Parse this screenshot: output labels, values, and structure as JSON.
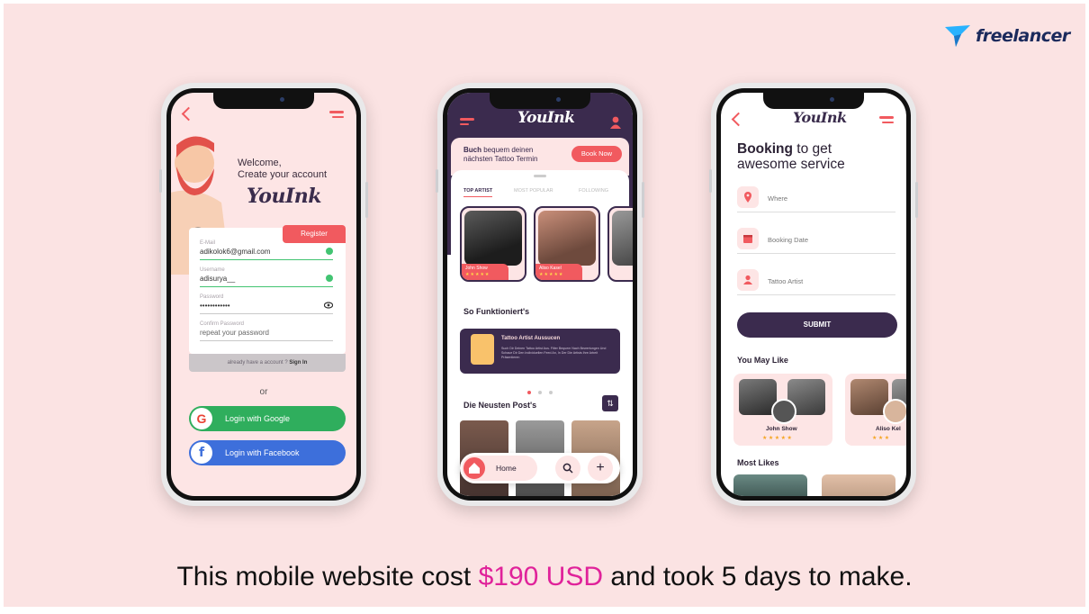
{
  "brand": {
    "name": "freelancer"
  },
  "caption": {
    "prefix": "This mobile website cost ",
    "price": "$190 USD",
    "suffix": " and took 5 days to make."
  },
  "colors": {
    "background": "#fbe3e3",
    "accent": "#f15a5f",
    "dark": "#3b2b4e",
    "price": "#e0229a",
    "google": "#2fae5d",
    "facebook": "#3d6fdb"
  },
  "app": {
    "name": "YouInk"
  },
  "signup": {
    "welcome_line1": "Welcome,",
    "welcome_line2": "Create your account",
    "register_label": "Register",
    "email_label": "E-Mail",
    "email_value": "adikolok6@gmail.com",
    "username_label": "Username",
    "username_value": "adisurya__",
    "password_label": "Password",
    "password_value": "••••••••••••",
    "confirm_label": "Confirm Password",
    "confirm_placeholder": "repeat your password",
    "already_text": "already have a account ?",
    "signin_label": "Sign In",
    "or_text": "or",
    "google_label": "Login with Google",
    "facebook_label": "Login with Facebook"
  },
  "home": {
    "promo_bold": "Buch",
    "promo_text1": " bequem deinen",
    "promo_text2": "nächsten Tattoo Termin",
    "book_now": "Book Now",
    "tabs": [
      "TOP ARTIST",
      "MOST POPULAR",
      "FOLLOWING"
    ],
    "artists": [
      {
        "name": "John Show",
        "stars": "★★★★★"
      },
      {
        "name": "Aliso Kasel",
        "stars": "★★★★★"
      }
    ],
    "how_title": "So Funktioniert's",
    "how_card_title": "Tattoo Artist Aussucen",
    "how_card_desc": "Such Dir Deinen Tattoo Artist Aus. Filter Bequem Nach Bewertungen Und Schaue Dir Den Individuellen Feed An, In Der Die Artists Ihre Arbeit Präsentieren",
    "posts_title": "Die Neusten Post's",
    "nav_home": "Home"
  },
  "booking": {
    "title_bold": "Booking",
    "title_rest1": " to get",
    "title_rest2": "awesome service",
    "fields": [
      "Where",
      "Booking Date",
      "Tattoo Artist"
    ],
    "submit": "SUBMIT",
    "you_may_like": "You May Like",
    "cards": [
      {
        "name": "John Show",
        "stars": "★★★★★"
      },
      {
        "name": "Aliso Kel",
        "stars": "★★★"
      }
    ],
    "most_likes": "Most Likes"
  }
}
